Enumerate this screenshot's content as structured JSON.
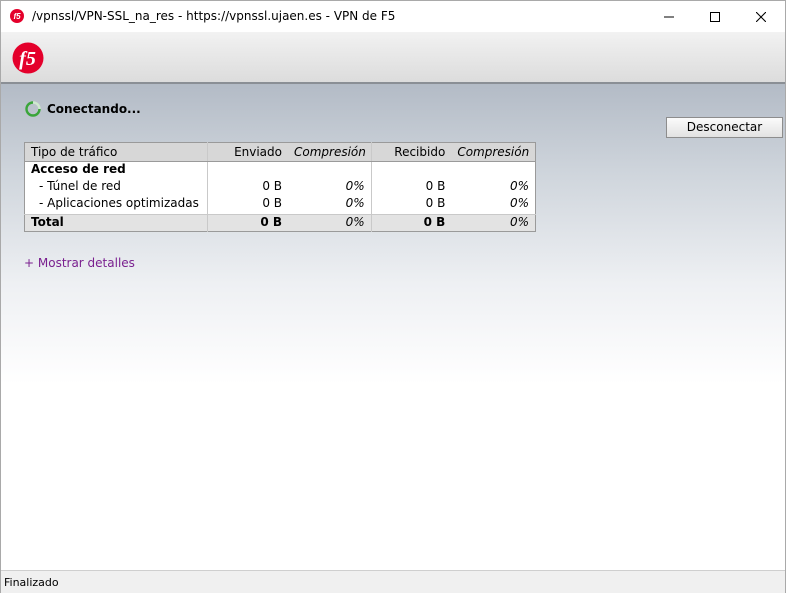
{
  "window": {
    "title": "/vpnssl/VPN-SSL_na_res - https://vpnssl.ujaen.es - VPN de F5",
    "icon": "f5-app-icon",
    "controls": [
      "minimize-icon",
      "maximize-icon",
      "close-icon"
    ]
  },
  "header": {
    "logo": "f5"
  },
  "connection": {
    "status": "Conectando...",
    "disconnect_label": "Desconectar"
  },
  "table": {
    "headers": {
      "type": "Tipo de tráfico",
      "sent": "Enviado",
      "sent_compression": "Compresión",
      "received": "Recibido",
      "received_compression": "Compresión"
    },
    "section": "Acceso de red",
    "rows": [
      {
        "name": "- Túnel de red",
        "sent": "0 B",
        "sent_comp": "0%",
        "recv": "0 B",
        "recv_comp": "0%"
      },
      {
        "name": "- Aplicaciones optimizadas",
        "sent": "0 B",
        "sent_comp": "0%",
        "recv": "0 B",
        "recv_comp": "0%"
      }
    ],
    "total": {
      "name": "Total",
      "sent": "0 B",
      "sent_comp": "0%",
      "recv": "0 B",
      "recv_comp": "0%"
    }
  },
  "details_link": "+ Mostrar detalles",
  "statusbar": {
    "text": "Finalizado"
  },
  "colors": {
    "f5_red": "#e4002b",
    "link": "#7a1f8f",
    "spinner": "#3aa53a"
  }
}
